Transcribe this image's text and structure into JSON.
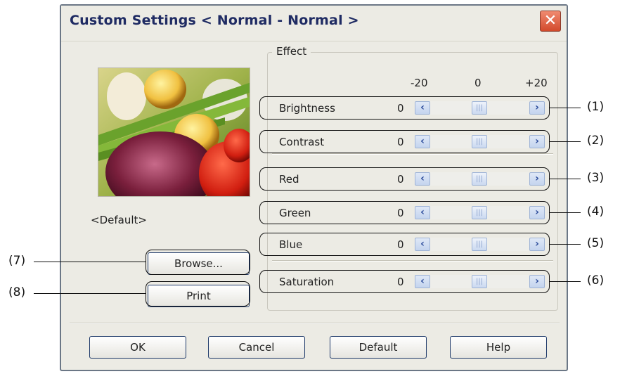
{
  "dialog": {
    "title": "Custom Settings  < Normal - Normal  >",
    "close_glyph": "✕"
  },
  "preview": {
    "caption": "<Default>"
  },
  "buttons": {
    "browse": "Browse...",
    "print": "Print",
    "ok": "OK",
    "cancel": "Cancel",
    "default": "Default",
    "help": "Help"
  },
  "effect": {
    "title": "Effect",
    "scale_min": "-20",
    "scale_mid": "0",
    "scale_max": "+20",
    "rows": [
      {
        "label": "Brightness",
        "value": "0",
        "callout": "(1)"
      },
      {
        "label": "Contrast",
        "value": "0",
        "callout": "(2)"
      },
      {
        "label": "Red",
        "value": "0",
        "callout": "(3)"
      },
      {
        "label": "Green",
        "value": "0",
        "callout": "(4)"
      },
      {
        "label": "Blue",
        "value": "0",
        "callout": "(5)"
      },
      {
        "label": "Saturation",
        "value": "0",
        "callout": "(6)"
      }
    ]
  },
  "callouts": {
    "browse": "(7)",
    "print": "(8)"
  },
  "icons": {
    "left_arrow": "chevron-left-icon",
    "right_arrow": "chevron-right-icon",
    "thumb": "slider-thumb-icon",
    "close": "close-icon"
  },
  "colors": {
    "title_text": "#1f2b63",
    "close_button": "#d24a2c",
    "dialog_bg": "#ecebe4"
  }
}
